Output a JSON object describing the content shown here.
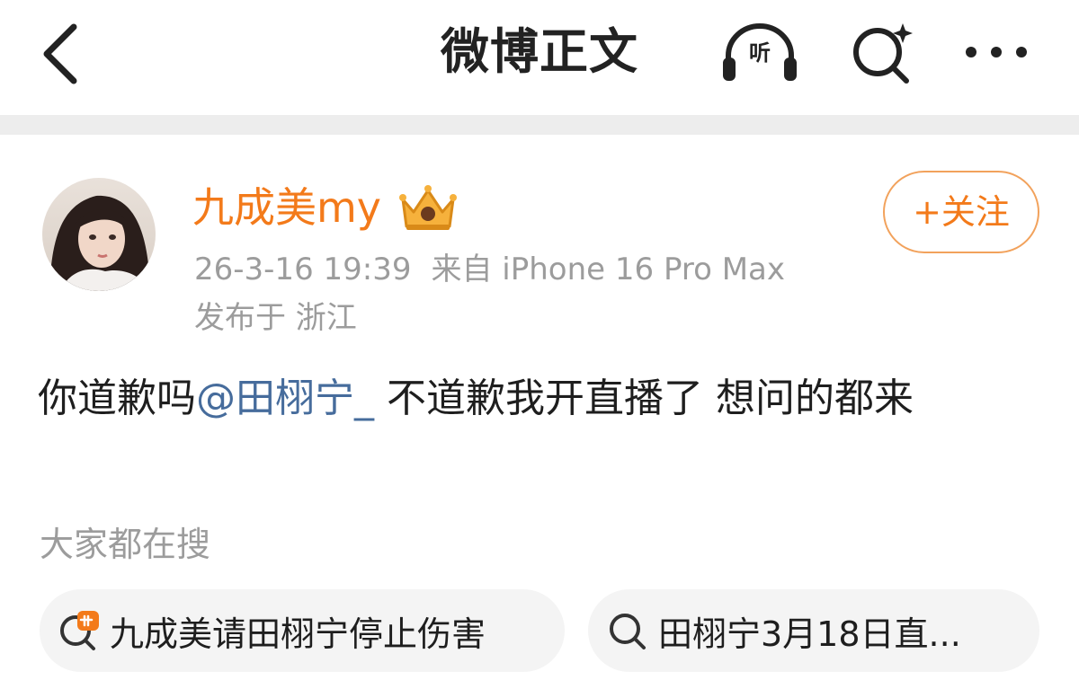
{
  "header": {
    "title": "微博正文",
    "listen_label": "听",
    "icons": [
      "back-arrow-icon",
      "headphones-icon",
      "ai-search-icon",
      "more-dots-icon"
    ]
  },
  "post": {
    "author": {
      "name": "九成美my",
      "badge_icon": "crown-icon"
    },
    "follow_label": "+关注",
    "timestamp": "26-3-16 19:39",
    "source": "来自 iPhone 16 Pro Max",
    "location": "发布于 浙江",
    "body": {
      "before_mention": "你道歉吗",
      "mention": "@田栩宁_",
      "after_mention": " 不道歉我开直播了 想问的都来"
    }
  },
  "search_section": {
    "title": "大家都在搜",
    "chips": [
      {
        "icon": "hot-search-icon",
        "label": "九成美请田栩宁停止伤害"
      },
      {
        "icon": "search-icon",
        "label": "田栩宁3月18日直..."
      }
    ]
  },
  "colors": {
    "accent": "#f37a1a",
    "mention": "#466c9c",
    "muted": "#9c9c9c",
    "separator": "#ededed",
    "chip_bg": "#f4f4f4"
  }
}
